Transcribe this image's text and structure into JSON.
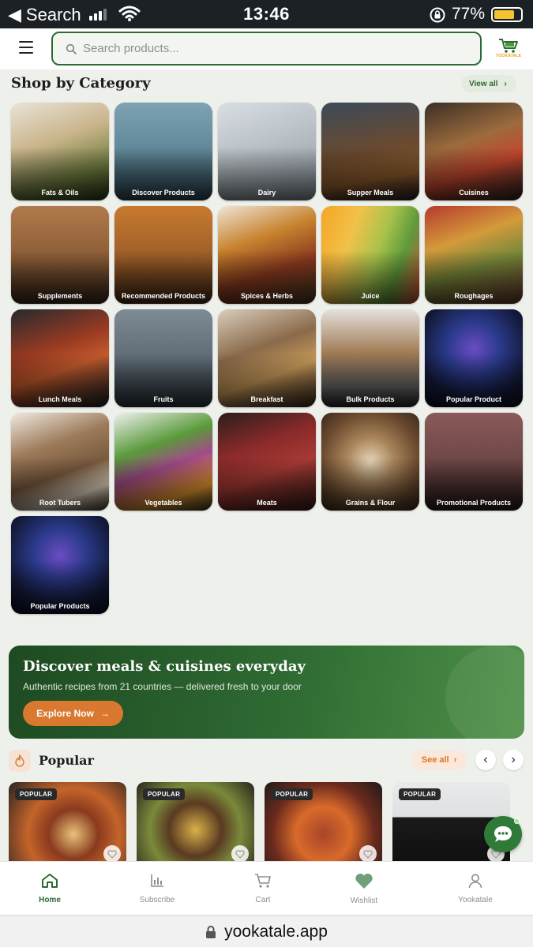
{
  "status_bar": {
    "back_label": "Search",
    "time": "13:46",
    "battery": "77%",
    "battery_level": 0.77,
    "battery_color": "#f4c430"
  },
  "header": {
    "menu_icon": "hamburger-icon",
    "search_placeholder": "Search products...",
    "logo_text": "YOOKATALE"
  },
  "categories_section": {
    "title": "Shop by Category",
    "view_all": "View all",
    "items": [
      {
        "label": "Fats & Oils",
        "bg": "linear-gradient(160deg,#e9e3d8 0%,#c9b48a 40%,#6b7a3a 75%,#2f3a1d 100%)"
      },
      {
        "label": "Discover Products",
        "bg": "linear-gradient(180deg,#7ea3b3 0%,#5f8798 50%,#2f4a58 100%)"
      },
      {
        "label": "Dairy",
        "bg": "linear-gradient(160deg,#d9dee2 0%,#b8c0c6 45%,#8b949b 100%)"
      },
      {
        "label": "Supper Meals",
        "bg": "linear-gradient(170deg,#3c4a5a 0%,#6b4a2f 50%,#8c5a2b 75%,#2a2320 100%)"
      },
      {
        "label": "Cuisines",
        "bg": "linear-gradient(160deg,#3b2f26 0%,#9c6b3d 40%,#c4472e 65%,#2a2420 100%)"
      },
      {
        "label": "Supplements",
        "bg": "linear-gradient(180deg,#b07a4c 0%,#8a5c36 55%,#3e2a1c 100%)"
      },
      {
        "label": "Recommended Products",
        "bg": "linear-gradient(180deg,#c87a30 0%,#9c5d28 55%,#4a2d16 100%)"
      },
      {
        "label": "Spices & Herbs",
        "bg": "linear-gradient(160deg,#efe6d6 0%,#c8832f 35%,#8c3a1e 65%,#4a3a24 100%)"
      },
      {
        "label": "Juice",
        "bg": "linear-gradient(110deg,#f4a623 0%,#f2c14a 30%,#a8c24b 55%,#5f9a3b 75%,#d84a3a 100%)"
      },
      {
        "label": "Roughages",
        "bg": "linear-gradient(160deg,#b53a2e 0%,#d49a3a 35%,#7a8a3a 60%,#6b3a2e 100%)"
      },
      {
        "label": "Lunch Meals",
        "bg": "linear-gradient(160deg,#262a2e 0%,#9a3a22 40%,#c25a2c 60%,#1f2226 100%)"
      },
      {
        "label": "Fruits",
        "bg": "linear-gradient(180deg,#7e8a94 0%,#5c6873 55%,#2f383f 100%)"
      },
      {
        "label": "Breakfast",
        "bg": "linear-gradient(160deg,#d9cdbb 0%,#8a6a4a 40%,#c99a5a 65%,#3a2a1e 100%)"
      },
      {
        "label": "Bulk Products",
        "bg": "linear-gradient(180deg,#e3e1dc 0%,#a07a52 45%,#6b6a6a 80%,#2a2a2a 100%)"
      },
      {
        "label": "Popular Product",
        "bg": "radial-gradient(circle at 50% 40%,#6a4cc4 0%,#2a3a8a 35%,#131a3a 70%,#0a0e1e 100%)"
      },
      {
        "label": "Root Tubers",
        "bg": "linear-gradient(160deg,#efe9df 0%,#9c7a5a 35%,#7a5a3e 60%,#e8dcc8 80%,#4a3a2a 100%)"
      },
      {
        "label": "Vegetables",
        "bg": "linear-gradient(160deg,#eef0ee 0%,#5a9a3a 35%,#a34a8a 55%,#e89a2a 80%,#3a3a2a 100%)"
      },
      {
        "label": "Meats",
        "bg": "linear-gradient(160deg,#2a1e1c 0%,#8a2a2a 35%,#a83a34 60%,#3a1e1a 100%)"
      },
      {
        "label": "Grains & Flour",
        "bg": "radial-gradient(circle at 50% 50%,#e6d6b8 0%,#a8845a 35%,#6b4a2e 70%,#3a2a1e 100%)"
      },
      {
        "label": "Promotional Products",
        "bg": "linear-gradient(180deg,#8a5a5a 0%,#6b4444 55%,#2e1e1e 100%)"
      },
      {
        "label": "Popular Products",
        "bg": "radial-gradient(circle at 50% 40%,#6a4cc4 0%,#2a3a8a 35%,#131a3a 70%,#0a0e1e 100%)"
      }
    ]
  },
  "banner": {
    "title": "Discover meals & cuisines everyday",
    "subtitle": "Authentic recipes from 21 countries — delivered fresh to your door",
    "button": "Explore Now"
  },
  "popular": {
    "title": "Popular",
    "see_all": "See all",
    "items": [
      {
        "badge": "POPULAR",
        "bg": "radial-gradient(circle at 55% 60%,#e8c27a 0%,#8a3a1e 30%,#c4642a 55%,#2a2220 100%)"
      },
      {
        "badge": "POPULAR",
        "bg": "radial-gradient(circle at 50% 55%,#d9b24a 0%,#5a3a22 35%,#7a8a3a 60%,#2a2420 100%)"
      },
      {
        "badge": "POPULAR",
        "bg": "radial-gradient(circle at 50% 60%,#a8452a 0%,#d86a2a 35%,#6b2a1e 65%,#1e1a18 100%)"
      },
      {
        "badge": "POPULAR",
        "bg": "linear-gradient(180deg,#e9eaec 0%,#dfe0e2 40%,#1a1a1a 41%,#0e0e0e 100%)"
      }
    ]
  },
  "bottom_nav": [
    {
      "label": "Home",
      "icon": "home-icon",
      "active": true
    },
    {
      "label": "Subscribe",
      "icon": "bar-chart-icon"
    },
    {
      "label": "Cart",
      "icon": "cart-icon"
    },
    {
      "label": "Wishlist",
      "icon": "heart-icon"
    },
    {
      "label": "Yookatale",
      "icon": "user-icon"
    }
  ],
  "url_bar": {
    "url": "yookatale.app"
  },
  "colors": {
    "brand_green": "#2d6a32",
    "accent_orange": "#d9782f",
    "background": "#eef0ec"
  }
}
